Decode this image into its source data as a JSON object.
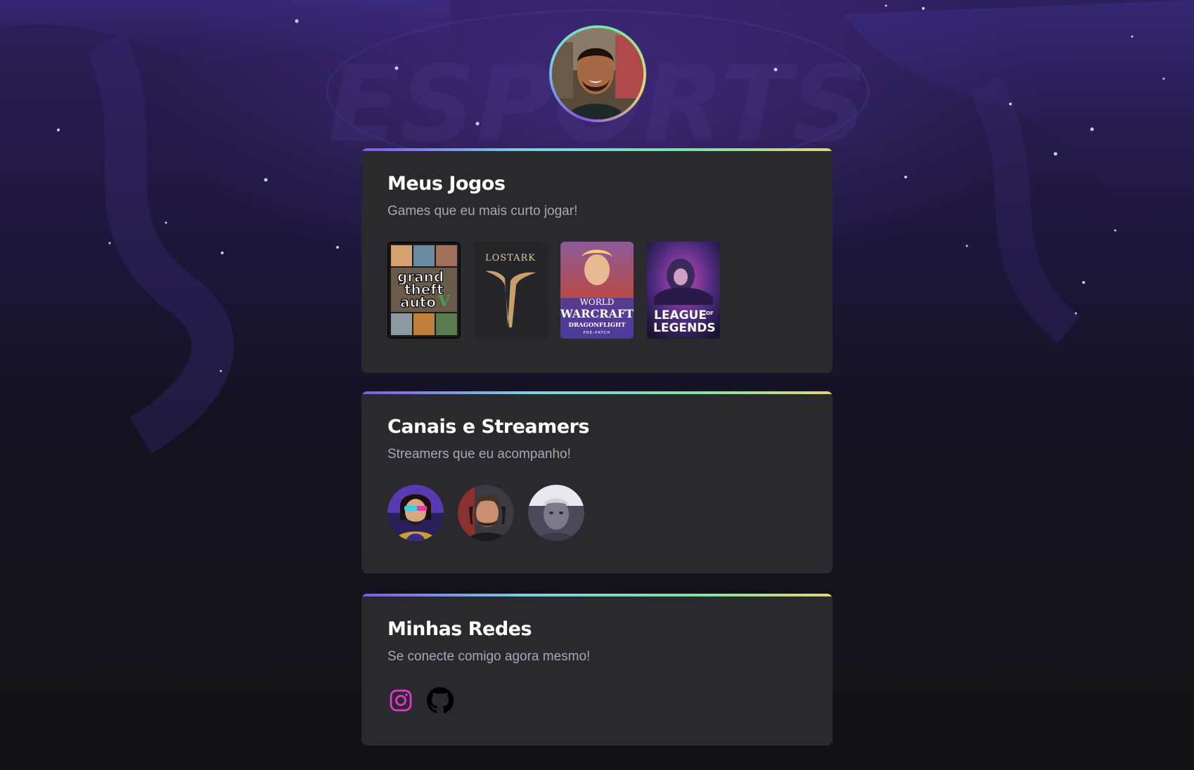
{
  "profile": {
    "avatar_icon": "profile-photo"
  },
  "background": {
    "watermark_text": "ESPORTS"
  },
  "games_section": {
    "title": "Meus Jogos",
    "subtitle": "Games que eu mais curto jogar!",
    "games": [
      {
        "name": "Grand Theft Auto V",
        "cover_lines": [
          "grand",
          "theft",
          "auto"
        ],
        "badge": "V"
      },
      {
        "name": "Lost Ark",
        "cover_text": "LOSTARK"
      },
      {
        "name": "World of Warcraft Dragonflight",
        "cover_top": "WORLD",
        "cover_main": "WARCRAFT",
        "cover_sub": "DRAGONFLIGHT",
        "cover_tag": "PRE-PATCH"
      },
      {
        "name": "League of Legends",
        "cover_top": "LEAGUE",
        "cover_of": "OF",
        "cover_bottom": "LEGENDS"
      }
    ]
  },
  "streamers_section": {
    "title": "Canais e Streamers",
    "subtitle": "Streamers que eu acompanho!",
    "streamers": [
      {
        "icon": "streamer-avatar-1"
      },
      {
        "icon": "streamer-avatar-2"
      },
      {
        "icon": "streamer-avatar-3"
      }
    ]
  },
  "social_section": {
    "title": "Minhas Redes",
    "subtitle": "Se conecte comigo agora mesmo!",
    "links": [
      {
        "icon": "instagram-icon",
        "color": "#e138c8"
      },
      {
        "icon": "github-icon",
        "color": "#000000"
      }
    ]
  },
  "colors": {
    "card_bg": "#29292e",
    "gradient": [
      "#8257e5",
      "#7ad3e0",
      "#79e6a6",
      "#e6d679"
    ],
    "title": "#ffffff",
    "subtitle": "#a8a8b3"
  }
}
